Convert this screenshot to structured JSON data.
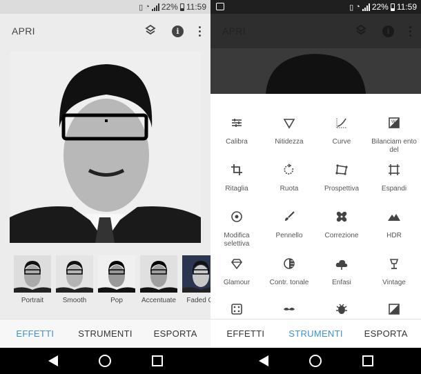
{
  "status": {
    "battery_pct": "22%",
    "time": "11:59"
  },
  "left": {
    "title": "APRI",
    "filters": [
      {
        "label": "Portrait"
      },
      {
        "label": "Smooth"
      },
      {
        "label": "Pop"
      },
      {
        "label": "Accentuate"
      },
      {
        "label": "Faded Gl"
      }
    ],
    "tabs": [
      "EFFETTI",
      "STRUMENTI",
      "ESPORTA"
    ],
    "active_tab": "EFFETTI"
  },
  "right": {
    "title": "APRI",
    "tools": [
      {
        "label": "Calibra",
        "icon": "sliders-icon"
      },
      {
        "label": "Nitidezza",
        "icon": "triangle-icon"
      },
      {
        "label": "Curve",
        "icon": "curve-icon"
      },
      {
        "label": "Bilanciam ento del",
        "icon": "white-balance-icon"
      },
      {
        "label": "Ritaglia",
        "icon": "crop-icon"
      },
      {
        "label": "Ruota",
        "icon": "rotate-icon"
      },
      {
        "label": "Prospettiva",
        "icon": "perspective-icon"
      },
      {
        "label": "Espandi",
        "icon": "expand-icon"
      },
      {
        "label": "Modifica selettiva",
        "icon": "target-icon"
      },
      {
        "label": "Pennello",
        "icon": "brush-icon"
      },
      {
        "label": "Correzione",
        "icon": "bandage-icon"
      },
      {
        "label": "HDR",
        "icon": "mountain-icon"
      },
      {
        "label": "Glamour",
        "icon": "diamond-icon"
      },
      {
        "label": "Contr. tonale",
        "icon": "tonal-icon"
      },
      {
        "label": "Enfasi",
        "icon": "cloud-icon"
      },
      {
        "label": "Vintage",
        "icon": "lamp-icon"
      },
      {
        "label": "",
        "icon": "dice-icon"
      },
      {
        "label": "",
        "icon": "mustache-icon"
      },
      {
        "label": "",
        "icon": "bug-icon"
      },
      {
        "label": "",
        "icon": "frame-icon"
      }
    ],
    "tabs": [
      "EFFETTI",
      "STRUMENTI",
      "ESPORTA"
    ],
    "active_tab": "STRUMENTI"
  },
  "colors": {
    "accent": "#3a8fd8"
  }
}
